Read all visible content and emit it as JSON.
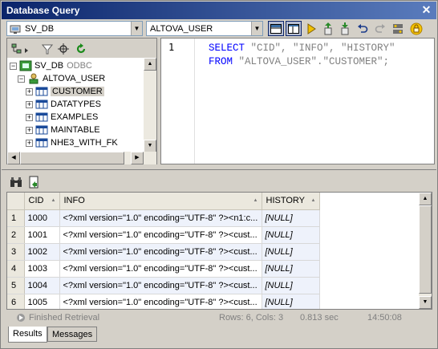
{
  "window": {
    "title": "Database Query",
    "close_glyph": "✕"
  },
  "toolbar": {
    "datasource": "SV_DB",
    "schema": "ALTOVA_USER",
    "buttons": [
      "layout-horizontal-icon",
      "layout-vertical-icon",
      "execute-icon",
      "import-icon",
      "export-icon",
      "undo-icon",
      "redo-icon",
      "options-icon",
      "disconnect-icon"
    ]
  },
  "tree": {
    "root": {
      "label": "SV_DB",
      "sub": "ODBC"
    },
    "schema": "ALTOVA_USER",
    "tables": [
      "CUSTOMER",
      "DATATYPES",
      "EXAMPLES",
      "MAINTABLE",
      "NHE3_WITH_FK"
    ]
  },
  "editor": {
    "line_number": "1",
    "select_kw": "SELECT",
    "columns": "\"CID\", \"INFO\", \"HISTORY\"",
    "from_kw": "FROM",
    "table": "\"ALTOVA_USER\".\"CUSTOMER\";"
  },
  "results": {
    "columns": [
      "CID",
      "INFO",
      "HISTORY"
    ],
    "rows": [
      {
        "rn": "1",
        "cid": "1000",
        "info": "<?xml version=\"1.0\" encoding=\"UTF-8\" ?><n1:c...",
        "history": "[NULL]"
      },
      {
        "rn": "2",
        "cid": "1001",
        "info": "<?xml version=\"1.0\" encoding=\"UTF-8\" ?><cust...",
        "history": "[NULL]"
      },
      {
        "rn": "3",
        "cid": "1002",
        "info": "<?xml version=\"1.0\" encoding=\"UTF-8\" ?><cust...",
        "history": "[NULL]"
      },
      {
        "rn": "4",
        "cid": "1003",
        "info": "<?xml version=\"1.0\" encoding=\"UTF-8\" ?><cust...",
        "history": "[NULL]"
      },
      {
        "rn": "5",
        "cid": "1004",
        "info": "<?xml version=\"1.0\" encoding=\"UTF-8\" ?><cust...",
        "history": "[NULL]"
      },
      {
        "rn": "6",
        "cid": "1005",
        "info": "<?xml version=\"1.0\" encoding=\"UTF-8\" ?><cust...",
        "history": "[NULL]"
      }
    ]
  },
  "status": {
    "state": "Finished Retrieval",
    "counts": "Rows: 6, Cols: 3",
    "duration": "0.813 sec",
    "time": "14:50:08"
  },
  "tabs": [
    "Results",
    "Messages"
  ],
  "colors": {
    "title_start": "#0a246a",
    "title_end": "#5a7cbd",
    "keyword": "#0000ff",
    "string": "#808080",
    "row_tint": "#eef2fb"
  }
}
